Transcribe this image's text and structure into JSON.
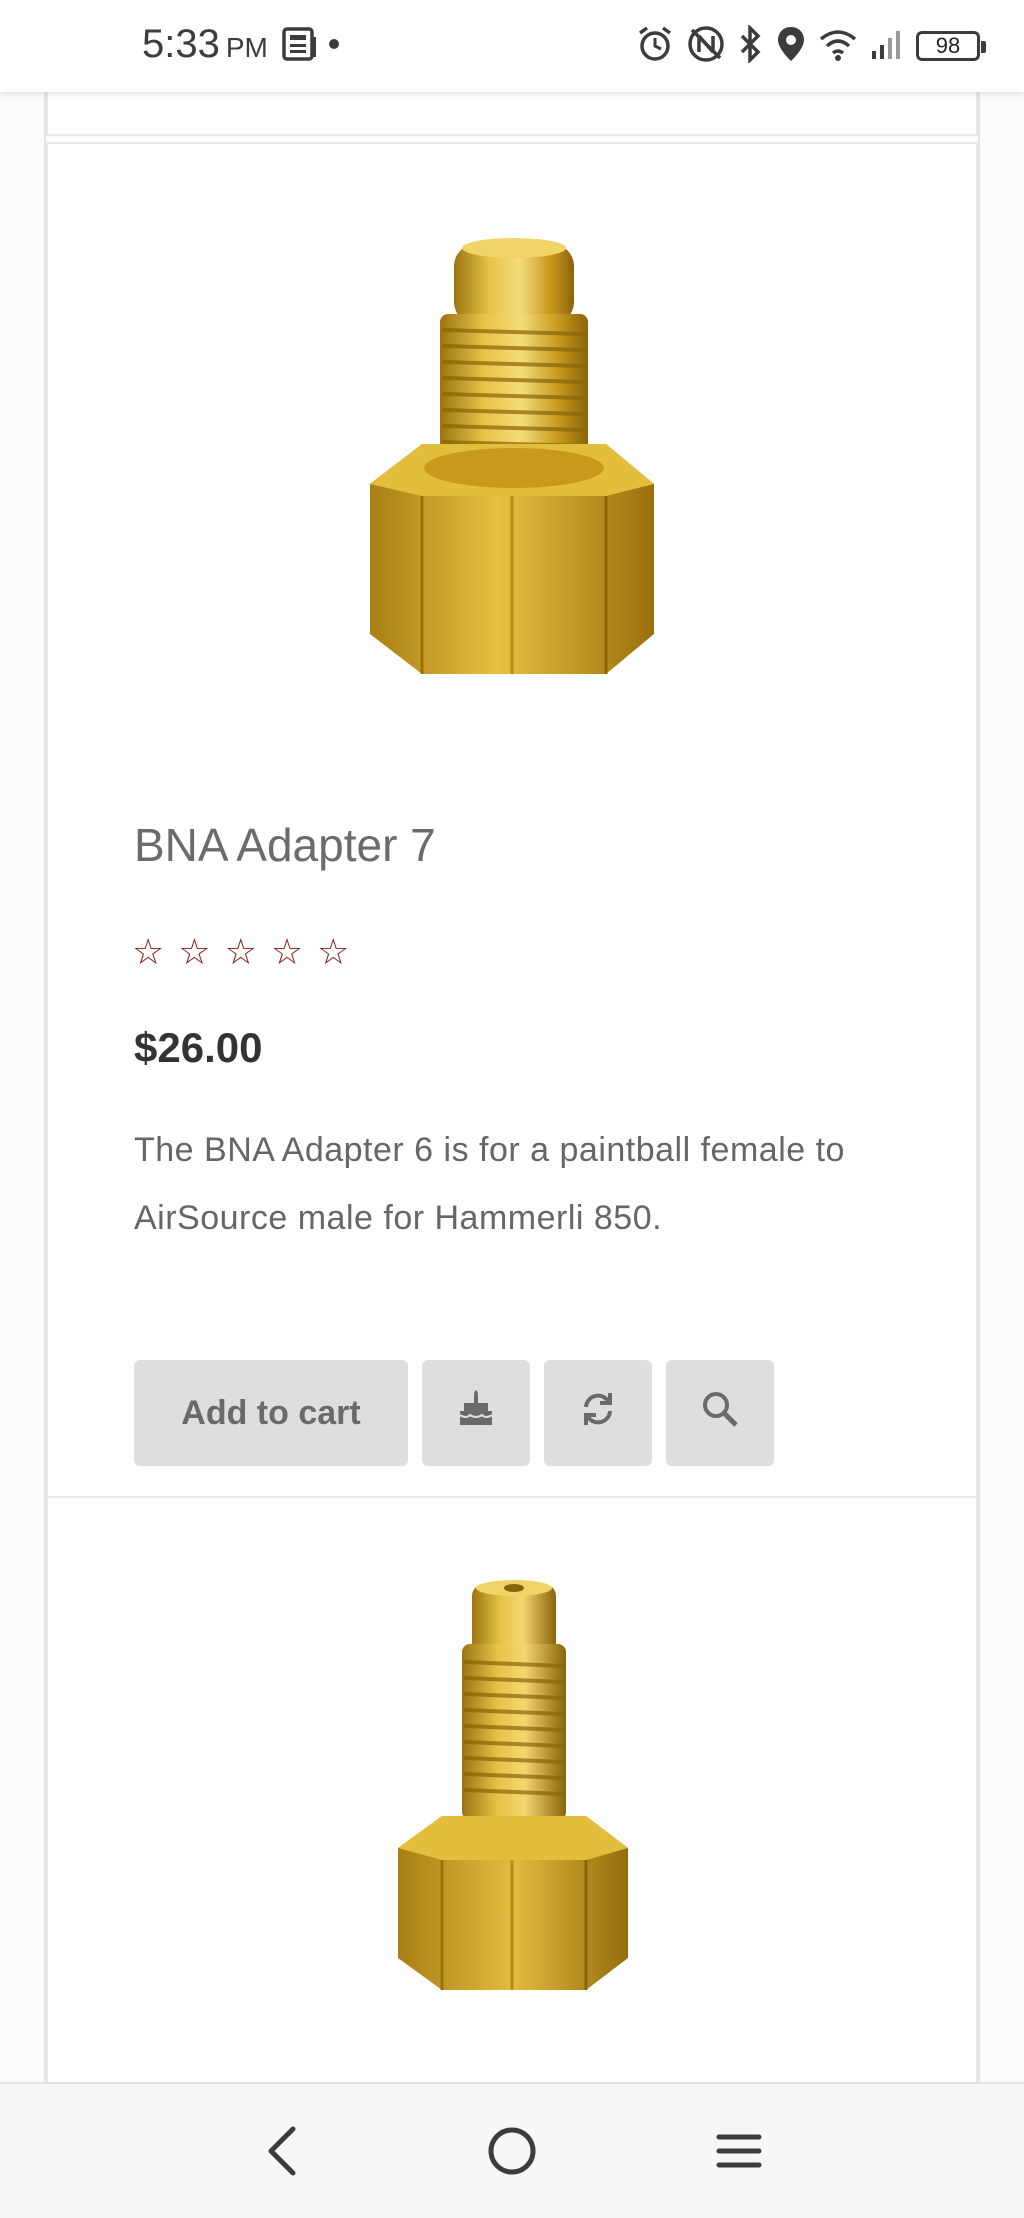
{
  "status_bar": {
    "time": "5:33",
    "ampm": "PM",
    "battery_level": "98",
    "icons": [
      "news-icon",
      "dot-icon",
      "alarm-icon",
      "nfc-off-icon",
      "bluetooth-icon",
      "location-icon",
      "wifi-icon",
      "signal-icon",
      "battery-icon"
    ]
  },
  "product": {
    "title": "BNA Adapter 7",
    "rating": 0,
    "max_rating": 5,
    "price": "$26.00",
    "description": "The BNA Adapter 6 is for a paintball female to AirSource male for Hammerli 850.",
    "add_to_cart_label": "Add to cart",
    "icons": [
      "gift-icon",
      "compare-icon",
      "search-icon"
    ]
  },
  "nav_bar": {
    "icons": [
      "back-icon",
      "home-icon",
      "menu-icon"
    ]
  },
  "colors": {
    "star": "#8b1a1a",
    "button_bg": "#dedede",
    "brass": "#d4a82a"
  }
}
